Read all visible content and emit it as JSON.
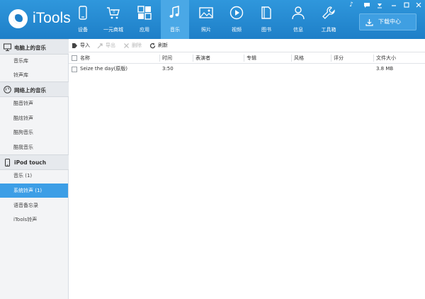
{
  "app": {
    "name": "iTools"
  },
  "nav": [
    {
      "label": "设备",
      "icon": "phone-icon"
    },
    {
      "label": "一元商城",
      "icon": "cart-icon"
    },
    {
      "label": "应用",
      "icon": "apps-icon"
    },
    {
      "label": "音乐",
      "icon": "music-icon",
      "active": true
    },
    {
      "label": "照片",
      "icon": "photo-icon"
    },
    {
      "label": "视频",
      "icon": "video-icon"
    },
    {
      "label": "图书",
      "icon": "book-icon"
    },
    {
      "label": "信息",
      "icon": "user-icon"
    },
    {
      "label": "工具箱",
      "icon": "wrench-icon"
    }
  ],
  "cart_count": "0",
  "download_center": "下载中心",
  "sidebar": {
    "sections": [
      {
        "title": "电脑上的音乐",
        "icon": "computer-icon",
        "items": [
          "音乐库",
          "铃声库"
        ]
      },
      {
        "title": "网络上的音乐",
        "icon": "globe-icon",
        "items": [
          "酷音铃声",
          "酷炫铃声",
          "酷狗音乐",
          "酷我音乐"
        ]
      },
      {
        "title": "iPod touch",
        "icon": "device-icon",
        "items": [
          "音乐 (1)",
          "系统铃声 (1)",
          "语音备忘录",
          "iTools铃声"
        ]
      }
    ],
    "active_item": "系统铃声 (1)"
  },
  "toolbar": {
    "import": "导入",
    "export": "导出",
    "delete": "删除",
    "refresh": "刷新"
  },
  "table": {
    "columns": [
      "名称",
      "时间",
      "表演者",
      "专辑",
      "风格",
      "评分",
      "文件大小"
    ],
    "rows": [
      {
        "name": "Seize the day(原版)",
        "time": "3:50",
        "artist": "",
        "album": "",
        "genre": "",
        "rating": "",
        "size": "3.8 MB"
      }
    ]
  },
  "colors": {
    "topbar": "#2a8fd6",
    "active_nav": "#4aa8e6",
    "selected_item": "#3c9ee6"
  }
}
